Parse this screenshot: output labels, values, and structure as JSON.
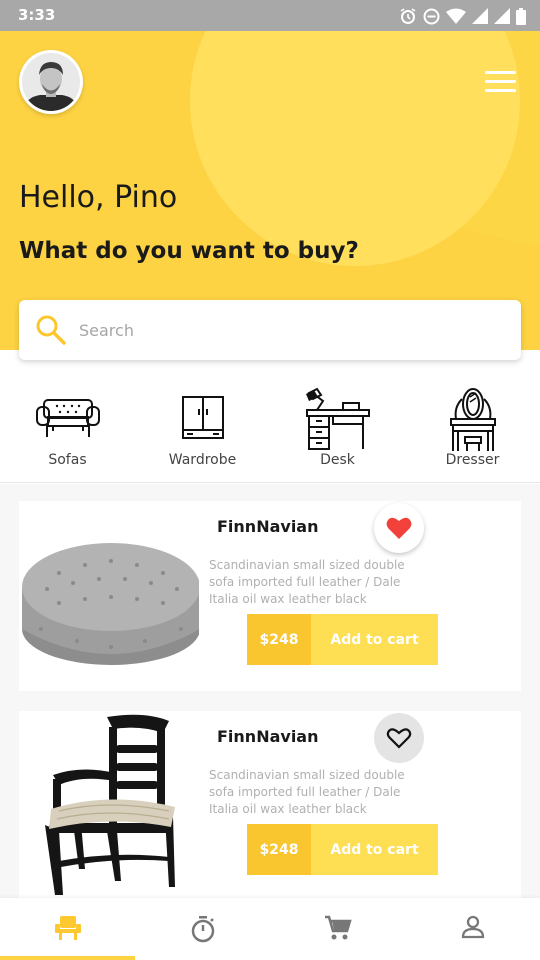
{
  "status_bar": {
    "time": "3:33",
    "icons": [
      "alarm-icon",
      "do-not-disturb-icon",
      "wifi-icon",
      "signal-icon",
      "signal-icon",
      "battery-icon"
    ]
  },
  "header": {
    "greeting": "Hello, Pino",
    "question": "What do you want to buy?",
    "accent_color": "#fdd343"
  },
  "search": {
    "placeholder": "Search"
  },
  "categories": [
    {
      "label": "Sofas",
      "icon": "sofa-icon"
    },
    {
      "label": "Wardrobe",
      "icon": "wardrobe-icon"
    },
    {
      "label": "Desk",
      "icon": "desk-icon"
    },
    {
      "label": "Dresser",
      "icon": "dresser-icon"
    }
  ],
  "products": [
    {
      "title": "FinnNavian",
      "description": "Scandinavian small sized double sofa imported full leather / Dale Italia oil wax leather black",
      "price": "$248",
      "cart_label": "Add to cart",
      "favorite": true,
      "image": "tufted-ottoman-image"
    },
    {
      "title": "FinnNavian",
      "description": "Scandinavian small sized double sofa imported full leather / Dale Italia oil wax leather black",
      "price": "$248",
      "cart_label": "Add to cart",
      "favorite": false,
      "image": "wooden-armchair-image"
    }
  ],
  "bottom_nav": [
    {
      "icon": "chair-icon",
      "active": true
    },
    {
      "icon": "timer-icon",
      "active": false
    },
    {
      "icon": "cart-icon",
      "active": false
    },
    {
      "icon": "profile-icon",
      "active": false
    }
  ]
}
